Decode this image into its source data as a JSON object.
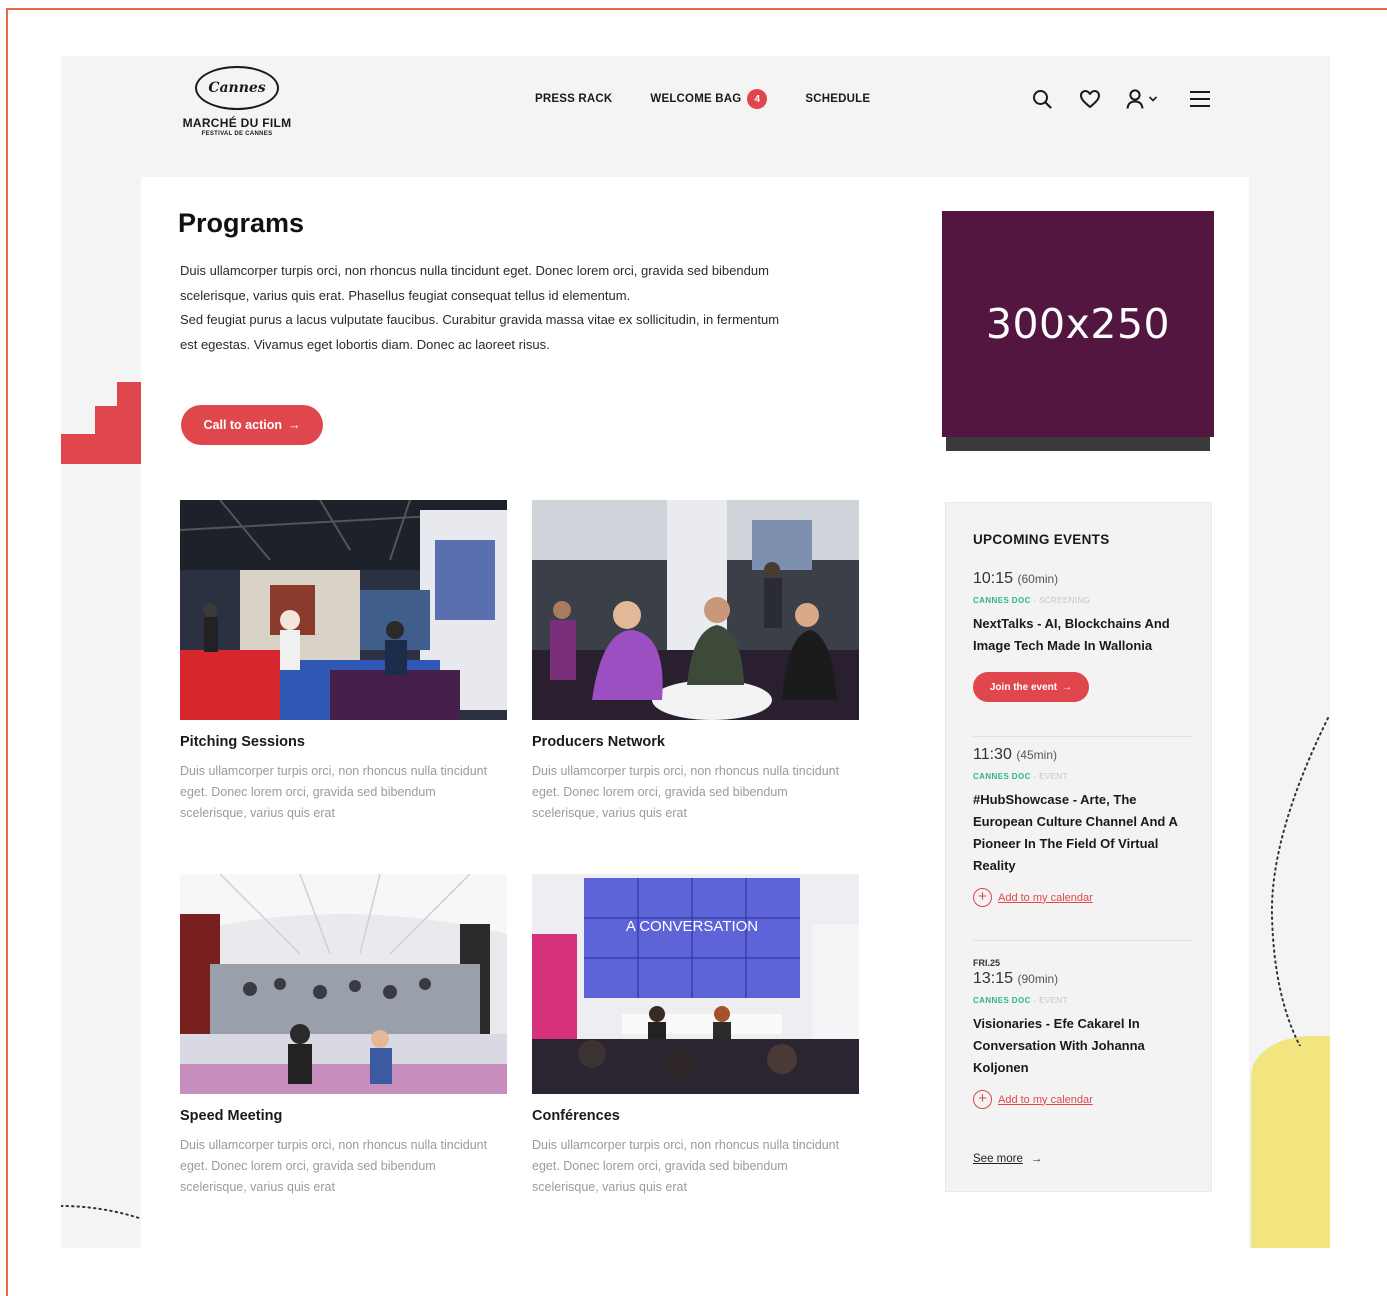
{
  "header": {
    "logo": {
      "mark": "Cannes",
      "title": "MARCHÉ DU FILM",
      "subtitle": "FESTIVAL DE CANNES"
    },
    "nav": [
      {
        "label": "PRESS RACK"
      },
      {
        "label": "WELCOME BAG",
        "badge": "4"
      },
      {
        "label": "SCHEDULE"
      }
    ],
    "tools": [
      "search-icon",
      "heart-icon",
      "user-icon",
      "chevron-down-icon",
      "menu-icon"
    ]
  },
  "main": {
    "title": "Programs",
    "intro": [
      "Duis ullamcorper turpis orci, non rhoncus nulla tincidunt eget. Donec lorem orci, gravida sed bibendum scelerisque, varius quis erat. Phasellus feugiat consequat tellus id elementum.",
      "Sed feugiat purus a lacus vulputate faucibus. Curabitur gravida massa vitae ex sollicitudin, in fermentum est egestas. Vivamus eget lobortis diam. Donec ac laoreet risus."
    ],
    "cta_label": "Call to action",
    "cta_arrow": "→",
    "programs": [
      {
        "name": "Pitching Sessions",
        "description": "Duis ullamcorper turpis orci, non rhoncus nulla tincidunt eget. Donec lorem orci, gravida sed bibendum scelerisque, varius quis erat"
      },
      {
        "name": "Producers Network",
        "description": "Duis ullamcorper turpis orci, non rhoncus nulla tincidunt eget. Donec lorem orci, gravida sed bibendum scelerisque, varius quis erat"
      },
      {
        "name": "Speed Meeting",
        "description": "Duis ullamcorper turpis orci, non rhoncus nulla tincidunt eget. Donec lorem orci, gravida sed bibendum scelerisque, varius quis erat"
      },
      {
        "name": "Conférences",
        "description": "Duis ullamcorper turpis orci, non rhoncus nulla tincidunt eget. Donec lorem orci, gravida sed bibendum scelerisque, varius quis erat",
        "screen_text": "A CONVERSATION"
      }
    ]
  },
  "sidebar": {
    "ad_label": "300x250",
    "upcoming": {
      "heading": "UPCOMING EVENTS",
      "events": [
        {
          "time": "10:15",
          "duration": "(60min)",
          "tag": "CANNES DOC",
          "tag_type": "- SCREENING",
          "title": "NextTalks - AI, Blockchains And Image Tech Made In Wallonia",
          "action": "Join the event",
          "action_arrow": "→"
        },
        {
          "time": "11:30",
          "duration": "(45min)",
          "tag": "CANNES DOC",
          "tag_type": "- EVENT",
          "title": "#HubShowcase - Arte, The European Culture Channel And A Pioneer In The Field Of Virtual Reality",
          "action": "Add to my calendar"
        },
        {
          "date": "FRI.25",
          "time": "13:15",
          "duration": "(90min)",
          "tag": "CANNES DOC",
          "tag_type": "- EVENT",
          "title": "Visionaries - Efe Cakarel In Conversation With Johanna Koljonen",
          "action": "Add to my calendar"
        }
      ],
      "see_more": "See more",
      "see_more_arrow": "→"
    }
  },
  "colors": {
    "accent": "#e0474c",
    "ad": "#521640",
    "tag": "#2fb58a",
    "yellow": "#f2e47e",
    "frame": "#e8694a"
  }
}
